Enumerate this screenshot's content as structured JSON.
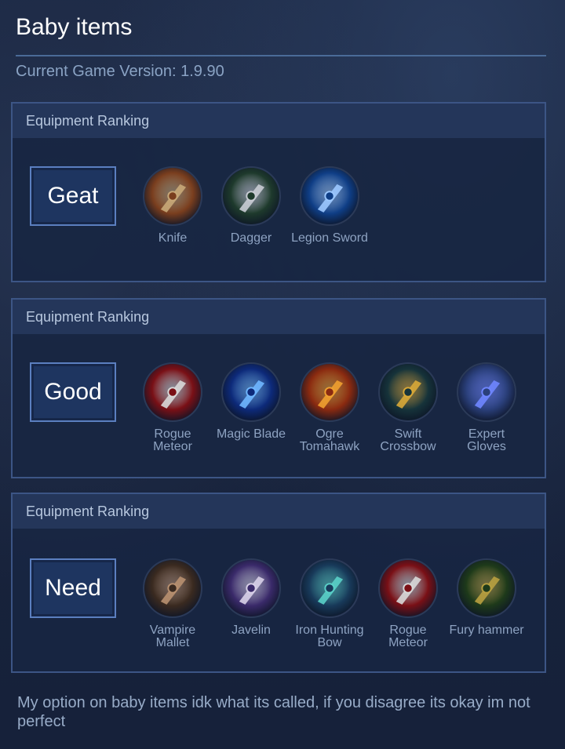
{
  "page": {
    "title": "Baby items",
    "version": "Current Game Version: 1.9.90",
    "note": "My option on baby items idk what its called, if you disagree its okay im not perfect"
  },
  "panels": [
    {
      "header": "Equipment Ranking",
      "tier": "Geat",
      "items": [
        {
          "name": "Knife",
          "icon": "knife-icon",
          "colors": [
            "#7a3e1e",
            "#c8a878"
          ]
        },
        {
          "name": "Dagger",
          "icon": "dagger-icon",
          "colors": [
            "#1e3a2c",
            "#c9ccd4"
          ]
        },
        {
          "name": "Legion Sword",
          "icon": "legion-sword-icon",
          "colors": [
            "#0f3e86",
            "#9cc8ff"
          ]
        }
      ]
    },
    {
      "header": "Equipment Ranking",
      "tier": "Good",
      "items": [
        {
          "name": "Rogue Meteor",
          "icon": "rogue-meteor-icon",
          "colors": [
            "#7a1016",
            "#d8d8d8"
          ]
        },
        {
          "name": "Magic Blade",
          "icon": "magic-blade-icon",
          "colors": [
            "#0d2a7a",
            "#6fb6ff"
          ]
        },
        {
          "name": "Ogre Tomahawk",
          "icon": "ogre-tomahawk-icon",
          "colors": [
            "#8a2a10",
            "#f0a030"
          ]
        },
        {
          "name": "Swift Crossbow",
          "icon": "swift-crossbow-icon",
          "colors": [
            "#16333a",
            "#d8a838"
          ]
        },
        {
          "name": "Expert Gloves",
          "icon": "expert-gloves-icon",
          "colors": [
            "#2a3f7a",
            "#6f86ff"
          ]
        }
      ]
    },
    {
      "header": "Equipment Ranking",
      "tier": "Need",
      "items": [
        {
          "name": "Vampire Mallet",
          "icon": "vampire-mallet-icon",
          "colors": [
            "#3a2a20",
            "#b89070"
          ]
        },
        {
          "name": "Javelin",
          "icon": "javelin-icon",
          "colors": [
            "#3a2a6a",
            "#d8d0e8"
          ]
        },
        {
          "name": "Iron Hunting Bow",
          "icon": "iron-hunting-bow-icon",
          "colors": [
            "#183a5a",
            "#5ad0c8"
          ]
        },
        {
          "name": "Rogue Meteor",
          "icon": "rogue-meteor-icon",
          "colors": [
            "#7a1016",
            "#d8d8d8"
          ]
        },
        {
          "name": "Fury hammer",
          "icon": "fury-hammer-icon",
          "colors": [
            "#1e3a1a",
            "#b8a040"
          ]
        }
      ]
    }
  ]
}
